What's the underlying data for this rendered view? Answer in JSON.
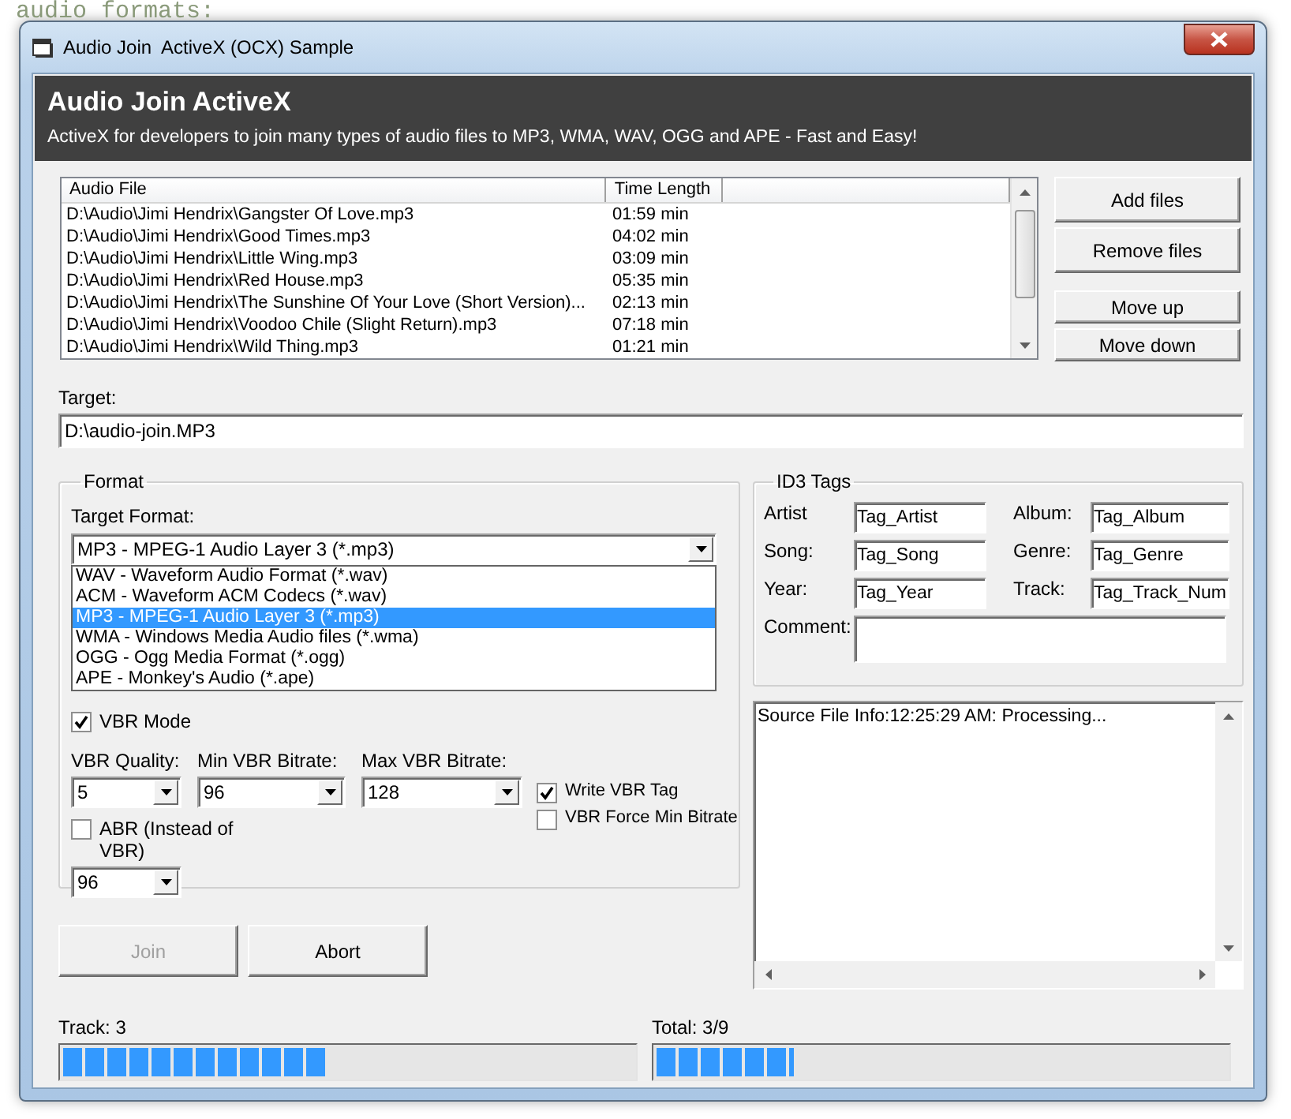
{
  "background": {
    "text": "audio formats:"
  },
  "window": {
    "title": "Audio Join  ActiveX (OCX) Sample"
  },
  "header": {
    "title": "Audio Join ActiveX",
    "subtitle": "ActiveX for developers to join many types of audio files to MP3, WMA, WAV, OGG and APE - Fast and Easy!"
  },
  "file_list": {
    "columns": [
      "Audio File",
      "Time Length"
    ],
    "rows": [
      {
        "file": "D:\\Audio\\Jimi Hendrix\\Gangster Of Love.mp3",
        "time": "01:59 min"
      },
      {
        "file": "D:\\Audio\\Jimi Hendrix\\Good Times.mp3",
        "time": "04:02 min"
      },
      {
        "file": "D:\\Audio\\Jimi Hendrix\\Little Wing.mp3",
        "time": "03:09 min"
      },
      {
        "file": "D:\\Audio\\Jimi Hendrix\\Red House.mp3",
        "time": "05:35 min"
      },
      {
        "file": "D:\\Audio\\Jimi Hendrix\\The Sunshine Of Your Love (Short Version)...",
        "time": "02:13 min"
      },
      {
        "file": "D:\\Audio\\Jimi Hendrix\\Voodoo Chile (Slight Return).mp3",
        "time": "07:18 min"
      },
      {
        "file": "D:\\Audio\\Jimi Hendrix\\Wild Thing.mp3",
        "time": "01:21 min"
      }
    ]
  },
  "side_buttons": [
    "Add files",
    "Remove files",
    "Move up",
    "Move down"
  ],
  "target": {
    "label": "Target:",
    "value": "D:\\audio-join.MP3"
  },
  "format": {
    "title": "Format",
    "target_format_label": "Target Format:",
    "target_format": {
      "value": "MP3 - MPEG-1 Audio Layer 3 (*.mp3)",
      "expanded": true,
      "options": [
        {
          "label": "WAV - Waveform Audio Format (*.wav)",
          "selected": false
        },
        {
          "label": "ACM - Waveform ACM Codecs (*.wav)",
          "selected": false
        },
        {
          "label": "MP3 - MPEG-1 Audio Layer 3 (*.mp3)",
          "selected": true
        },
        {
          "label": "WMA - Windows Media Audio files (*.wma)",
          "selected": false
        },
        {
          "label": "OGG - Ogg Media Format (*.ogg)",
          "selected": false
        },
        {
          "label": "APE - Monkey's Audio (*.ape)",
          "selected": false
        }
      ]
    },
    "vbr_mode": {
      "label": "VBR Mode",
      "checked": true
    },
    "combos": [
      {
        "label": "VBR Quality:",
        "value": "5"
      },
      {
        "label": "Min VBR Bitrate:",
        "value": "96"
      },
      {
        "label": "Max VBR Bitrate:",
        "value": "128"
      }
    ],
    "checks": [
      {
        "label": "Write VBR Tag",
        "checked": true
      },
      {
        "label": "VBR Force Min Bitrate",
        "checked": false
      }
    ],
    "abr": {
      "label": "ABR (Instead of VBR)",
      "checked": false,
      "value": "96"
    }
  },
  "id3": {
    "title": "ID3 Tags",
    "fields": [
      {
        "label": "Artist",
        "value": "Tag_Artist"
      },
      {
        "label": "Album:",
        "value": "Tag_Album"
      },
      {
        "label": "Song:",
        "value": "Tag_Song"
      },
      {
        "label": "Genre:",
        "value": "Tag_Genre"
      },
      {
        "label": "Year:",
        "value": "Tag_Year"
      },
      {
        "label": "Track:",
        "value": "Tag_Track_Num"
      }
    ],
    "comment_label": "Comment:"
  },
  "log": {
    "lines": [
      "Source File Info:12:25:29 AM: Processing..."
    ]
  },
  "actions": [
    {
      "label": "Join",
      "disabled": true
    },
    {
      "label": "Abort",
      "disabled": false
    }
  ],
  "progress": [
    {
      "label": "Track: 3",
      "level": 0.46
    },
    {
      "label": "Total: 3/9",
      "level": 0.24
    }
  ]
}
